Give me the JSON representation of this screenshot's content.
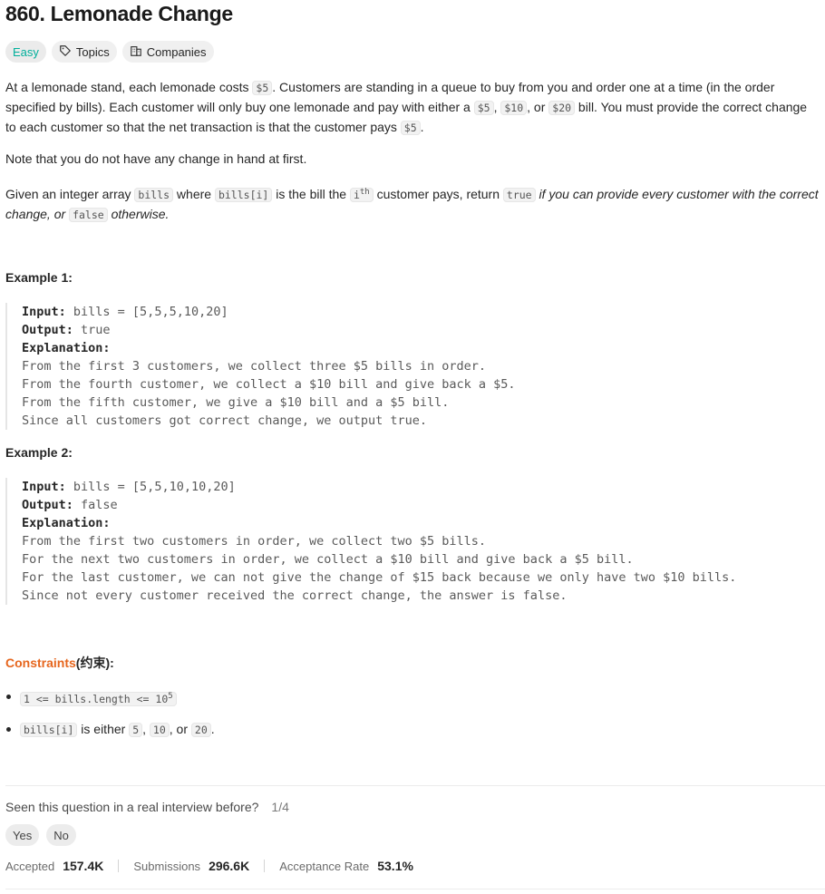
{
  "title": "860. Lemonade Change",
  "tags": {
    "difficulty": "Easy",
    "topics": "Topics",
    "companies": "Companies"
  },
  "description": {
    "p1_a": "At a lemonade stand, each lemonade costs ",
    "p1_code1": "$5",
    "p1_b": ". Customers are standing in a queue to buy from you and order one at a time (in the order specified by bills). Each customer will only buy one lemonade and pay with either a ",
    "p1_code2": "$5",
    "p1_c": ", ",
    "p1_code3": "$10",
    "p1_d": ", or ",
    "p1_code4": "$20",
    "p1_e": " bill. You must provide the correct change to each customer so that the net transaction is that the customer pays ",
    "p1_code5": "$5",
    "p1_f": ".",
    "p2": "Note that you do not have any change in hand at first.",
    "p3_a": "Given an integer array ",
    "p3_code1": "bills",
    "p3_b": " where ",
    "p3_code2": "bills[i]",
    "p3_c": " is the bill the ",
    "p3_code3": "i",
    "p3_code3_sup": "th",
    "p3_d": " customer pays, return ",
    "p3_code4": "true",
    "p3_e": " if you can provide every customer with the correct change, or ",
    "p3_code5": "false",
    "p3_f": " otherwise."
  },
  "examples": [
    {
      "heading": "Example 1:",
      "input_label": "Input:",
      "input": " bills = [5,5,5,10,20]",
      "output_label": "Output:",
      "output": " true",
      "explanation_label": "Explanation:",
      "lines": [
        "From the first 3 customers, we collect three $5 bills in order.",
        "From the fourth customer, we collect a $10 bill and give back a $5.",
        "From the fifth customer, we give a $10 bill and a $5 bill.",
        "Since all customers got correct change, we output true."
      ]
    },
    {
      "heading": "Example 2:",
      "input_label": "Input:",
      "input": " bills = [5,5,10,10,20]",
      "output_label": "Output:",
      "output": " false",
      "explanation_label": "Explanation:",
      "lines": [
        "From the first two customers in order, we collect two $5 bills.",
        "For the next two customers in order, we collect a $10 bill and give back a $5 bill.",
        "For the last customer, we can not give the change of $15 back because we only have two $10 bills.",
        "Since not every customer received the correct change, the answer is false."
      ]
    }
  ],
  "constraints": {
    "title_en": "Constraints",
    "title_cn": "(约束):",
    "c1_code": "1 <= bills.length <= 10",
    "c1_sup": "5",
    "c2_code1": "bills[i]",
    "c2_a": " is either ",
    "c2_code2": "5",
    "c2_b": ", ",
    "c2_code3": "10",
    "c2_c": ", or ",
    "c2_code4": "20",
    "c2_d": "."
  },
  "feedback": {
    "question": "Seen this question in a real interview before?",
    "count": "1/4",
    "yes": "Yes",
    "no": "No"
  },
  "stats": {
    "accepted_label": "Accepted",
    "accepted_value": "157.4K",
    "submissions_label": "Submissions",
    "submissions_value": "296.6K",
    "rate_label": "Acceptance Rate",
    "rate_value": "53.1%"
  },
  "icons": {
    "tag": "tag-icon",
    "building": "building-icon"
  },
  "colors": {
    "easy": "#00af9b",
    "constraints": "#e6661e"
  }
}
